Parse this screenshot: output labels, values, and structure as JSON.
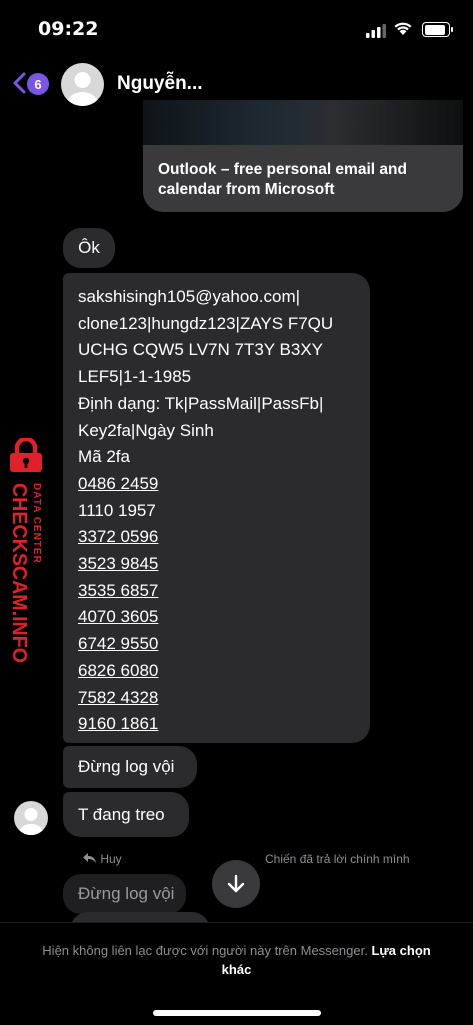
{
  "status_bar": {
    "time": "09:22"
  },
  "header": {
    "back_badge": "6",
    "contact_name": "Nguyễn..."
  },
  "link_preview": {
    "title": "Outlook – free personal email and calendar from Microsoft"
  },
  "messages": {
    "ok": "Ôk",
    "big_lines": [
      "sakshisingh105@yahoo.com|",
      "clone123|hungdz123|ZAYS F7QU",
      "UCHG CQW5 LV7N 7T3Y B3XY",
      "LEF5|1-1-1985",
      "Định dạng: Tk|PassMail|PassFb|",
      "Key2fa|Ngày Sinh",
      "Mã 2fa",
      "0486 2459",
      "1110 1957",
      "3372 0596",
      "3523 9845",
      "3535 6857",
      "4070 3605",
      "6742 9550",
      "6826 6080",
      "7582 4328",
      "9160 1861"
    ],
    "log": "Đừng log vội",
    "treo": "T đang treo",
    "reply_left": "Huy",
    "reply_right": "Chiến đã trả lời chính mình",
    "quoted": "Đừng log vội"
  },
  "footer": {
    "notice": "Hiện không liên lạc được với người này trên Messenger.",
    "action": "Lựa chọn khác"
  },
  "watermark": {
    "line1": "DATA CENTER",
    "line2": "CHECKSCAM.INFO"
  },
  "colors": {
    "accent": "#7b55e8",
    "bubble": "#2b2b2d",
    "watermark": "#e0202a"
  }
}
